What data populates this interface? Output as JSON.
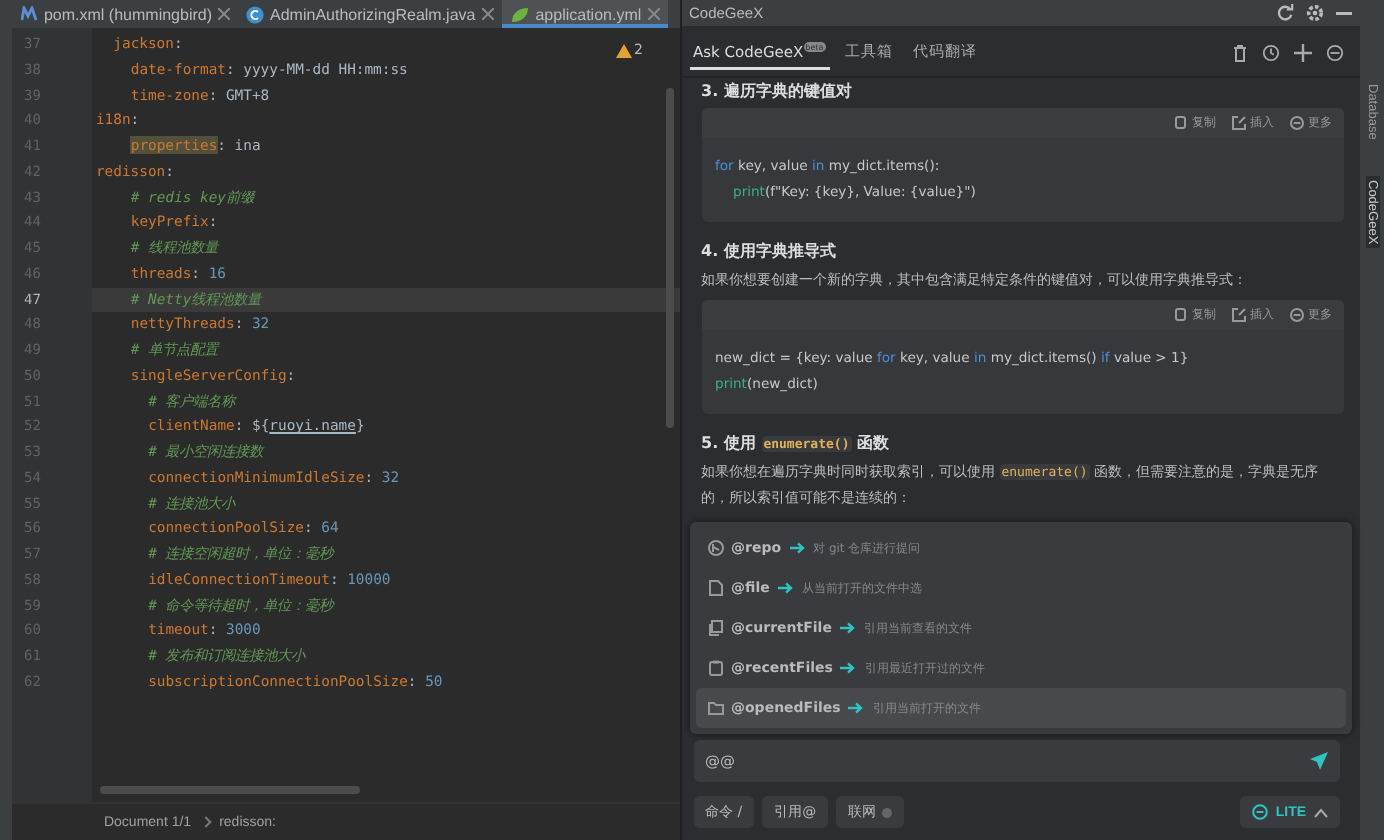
{
  "editor": {
    "tabs": [
      {
        "label": "pom.xml (hummingbird)",
        "selected": false
      },
      {
        "label": "AdminAuthorizingRealm.java",
        "selected": false
      },
      {
        "label": "application.yml",
        "selected": true
      }
    ],
    "warnings": "2",
    "lines": [
      {
        "number": "37",
        "current": false,
        "parts": [
          {
            "kind": "key",
            "text": "jackson"
          },
          {
            "kind": "plain",
            "text": ":"
          }
        ],
        "children": [
          {
            "number": "38",
            "current": false,
            "parts": [
              {
                "kind": "key",
                "text": "date-format"
              },
              {
                "kind": "plain",
                "text": ": yyyy-MM-dd HH:mm:ss"
              }
            ]
          },
          {
            "number": "39",
            "current": false,
            "parts": [
              {
                "kind": "key",
                "text": "time-zone"
              },
              {
                "kind": "plain",
                "text": ": GMT+8"
              }
            ]
          }
        ]
      },
      {
        "number": "40",
        "current": false,
        "root": true,
        "parts": [
          {
            "kind": "key",
            "text": "i18n"
          },
          {
            "kind": "plain",
            "text": ":"
          }
        ],
        "children": [
          {
            "number": "41",
            "current": false,
            "parts": [
              {
                "kind": "match",
                "text": "properties"
              },
              {
                "kind": "plain",
                "text": ": ina"
              }
            ]
          }
        ]
      },
      {
        "number": "42",
        "current": false,
        "root": true,
        "parts": [
          {
            "kind": "key",
            "text": "redisson"
          },
          {
            "kind": "plain",
            "text": ":"
          }
        ],
        "children": [
          {
            "number": "43",
            "current": false,
            "parts": [
              {
                "kind": "comment",
                "text": "# redis key前缀"
              }
            ]
          },
          {
            "number": "44",
            "current": false,
            "parts": [
              {
                "kind": "key",
                "text": "keyPrefix"
              },
              {
                "kind": "plain",
                "text": ":"
              }
            ]
          },
          {
            "number": "45",
            "current": false,
            "parts": [
              {
                "kind": "comment",
                "text": "# 线程池数量"
              }
            ]
          },
          {
            "number": "46",
            "current": false,
            "parts": [
              {
                "kind": "key",
                "text": "threads"
              },
              {
                "kind": "plain",
                "text": ": "
              },
              {
                "kind": "number",
                "text": "16"
              }
            ]
          },
          {
            "number": "47",
            "current": true,
            "parts": [
              {
                "kind": "comment",
                "text": "# Netty线程池数量"
              }
            ]
          },
          {
            "number": "48",
            "current": false,
            "parts": [
              {
                "kind": "key",
                "text": "nettyThreads"
              },
              {
                "kind": "plain",
                "text": ": "
              },
              {
                "kind": "number",
                "text": "32"
              }
            ]
          },
          {
            "number": "49",
            "current": false,
            "parts": [
              {
                "kind": "comment",
                "text": "# 单节点配置"
              }
            ]
          },
          {
            "number": "50",
            "current": false,
            "parts": [
              {
                "kind": "key",
                "text": "singleServerConfig"
              },
              {
                "kind": "plain",
                "text": ":"
              }
            ],
            "children": [
              {
                "number": "51",
                "current": false,
                "parts": [
                  {
                    "kind": "comment",
                    "text": "# 客户端名称"
                  }
                ]
              },
              {
                "number": "52",
                "current": false,
                "parts": [
                  {
                    "kind": "key",
                    "text": "clientName"
                  },
                  {
                    "kind": "plain",
                    "text": ": ${"
                  },
                  {
                    "kind": "link",
                    "text": "ruoyi.name"
                  },
                  {
                    "kind": "plain",
                    "text": "}"
                  }
                ]
              },
              {
                "number": "53",
                "current": false,
                "parts": [
                  {
                    "kind": "comment",
                    "text": "# 最小空闲连接数"
                  }
                ]
              },
              {
                "number": "54",
                "current": false,
                "parts": [
                  {
                    "kind": "key",
                    "text": "connectionMinimumIdleSize"
                  },
                  {
                    "kind": "plain",
                    "text": ": "
                  },
                  {
                    "kind": "number",
                    "text": "32"
                  }
                ]
              },
              {
                "number": "55",
                "current": false,
                "parts": [
                  {
                    "kind": "comment",
                    "text": "# 连接池大小"
                  }
                ]
              },
              {
                "number": "56",
                "current": false,
                "parts": [
                  {
                    "kind": "key",
                    "text": "connectionPoolSize"
                  },
                  {
                    "kind": "plain",
                    "text": ": "
                  },
                  {
                    "kind": "number",
                    "text": "64"
                  }
                ]
              },
              {
                "number": "57",
                "current": false,
                "parts": [
                  {
                    "kind": "comment",
                    "text": "# 连接空闲超时，单位：毫秒"
                  }
                ]
              },
              {
                "number": "58",
                "current": false,
                "parts": [
                  {
                    "kind": "key",
                    "text": "idleConnectionTimeout"
                  },
                  {
                    "kind": "plain",
                    "text": ": "
                  },
                  {
                    "kind": "number",
                    "text": "10000"
                  }
                ]
              },
              {
                "number": "59",
                "current": false,
                "parts": [
                  {
                    "kind": "comment",
                    "text": "# 命令等待超时，单位：毫秒"
                  }
                ]
              },
              {
                "number": "60",
                "current": false,
                "parts": [
                  {
                    "kind": "key",
                    "text": "timeout"
                  },
                  {
                    "kind": "plain",
                    "text": ": "
                  },
                  {
                    "kind": "number",
                    "text": "3000"
                  }
                ]
              },
              {
                "number": "61",
                "current": false,
                "parts": [
                  {
                    "kind": "comment",
                    "text": "# 发布和订阅连接池大小"
                  }
                ]
              },
              {
                "number": "62",
                "current": false,
                "parts": [
                  {
                    "kind": "key",
                    "text": "subscriptionConnectionPoolSize"
                  },
                  {
                    "kind": "plain",
                    "text": ": "
                  },
                  {
                    "kind": "number",
                    "text": "50"
                  }
                ]
              }
            ]
          }
        ]
      }
    ],
    "breadcrumbs": [
      "Document 1/1",
      "redisson:"
    ]
  },
  "assistant": {
    "title": "CodeGeeX",
    "tabs": [
      {
        "label": "Ask CodeGeeX",
        "badge": "beta",
        "selected": true
      },
      {
        "label": "工具箱",
        "selected": false
      },
      {
        "label": "代码翻译",
        "selected": false
      }
    ],
    "blocks": [
      {
        "kind": "heading",
        "parts": [
          {
            "kind": "text",
            "text": "3. 遍历字典的键值对"
          }
        ]
      },
      {
        "kind": "code",
        "actions": [
          "复制",
          "插入",
          "更多"
        ],
        "lines": [
          {
            "parts": [
              {
                "kind": "keyword",
                "text": "for"
              },
              {
                "kind": "plain",
                "text": " key, value "
              },
              {
                "kind": "keyword",
                "text": "in"
              },
              {
                "kind": "plain",
                "text": " my_dict.items():"
              }
            ],
            "children": [
              {
                "parts": [
                  {
                    "kind": "builtin",
                    "text": "print"
                  },
                  {
                    "kind": "plain",
                    "text": "(f\"Key: {key}, Value: {value}\")"
                  }
                ]
              }
            ]
          }
        ]
      },
      {
        "kind": "heading",
        "parts": [
          {
            "kind": "text",
            "text": "4. 使用字典推导式"
          }
        ]
      },
      {
        "kind": "paragraph",
        "parts": [
          {
            "kind": "text",
            "text": "如果你想要创建一个新的字典，其中包含满足特定条件的键值对，可以使用字典推导式："
          }
        ]
      },
      {
        "kind": "code",
        "actions": [
          "复制",
          "插入",
          "更多"
        ],
        "lines": [
          {
            "parts": [
              {
                "kind": "plain",
                "text": "new_dict = {key: value "
              },
              {
                "kind": "keyword",
                "text": "for"
              },
              {
                "kind": "plain",
                "text": " key, value "
              },
              {
                "kind": "keyword",
                "text": "in"
              },
              {
                "kind": "plain",
                "text": " my_dict.items() "
              },
              {
                "kind": "keyword",
                "text": "if"
              },
              {
                "kind": "plain",
                "text": " value > 1}"
              }
            ]
          },
          {
            "parts": [
              {
                "kind": "builtin",
                "text": "print"
              },
              {
                "kind": "plain",
                "text": "(new_dict)"
              }
            ]
          }
        ]
      },
      {
        "kind": "heading",
        "parts": [
          {
            "kind": "text",
            "text": "5. 使用 "
          },
          {
            "kind": "code",
            "text": "enumerate()"
          },
          {
            "kind": "text",
            "text": " 函数"
          }
        ]
      },
      {
        "kind": "paragraph",
        "parts": [
          {
            "kind": "text",
            "text": "如果你想在遍历字典时同时获取索引，可以使用 "
          },
          {
            "kind": "code",
            "text": "enumerate()"
          },
          {
            "kind": "text",
            "text": " 函数，但需要注意的是，字典是无序的，所以索引值可能不是连续的："
          }
        ]
      }
    ],
    "mentions": [
      {
        "label": "@repo",
        "hint": "对 git 仓库进行提问",
        "selected": false
      },
      {
        "label": "@file",
        "hint": "从当前打开的文件中选",
        "selected": false
      },
      {
        "label": "@currentFile",
        "hint": "引用当前查看的文件",
        "selected": false
      },
      {
        "label": "@recentFiles",
        "hint": "引用最近打开过的文件",
        "selected": false
      },
      {
        "label": "@openedFiles",
        "hint": "引用当前打开的文件",
        "selected": true
      }
    ],
    "input": {
      "value": "@@"
    },
    "buttons": [
      {
        "label": "命令 /",
        "kind": "plain"
      },
      {
        "label": "引用@",
        "kind": "plain"
      },
      {
        "label": "联网",
        "kind": "toggle",
        "on": false
      }
    ],
    "mode": {
      "label": "LITE"
    }
  },
  "side_strip": [
    {
      "label": "Database",
      "selected": false
    },
    {
      "label": "CodeGeeX",
      "selected": true
    }
  ]
}
